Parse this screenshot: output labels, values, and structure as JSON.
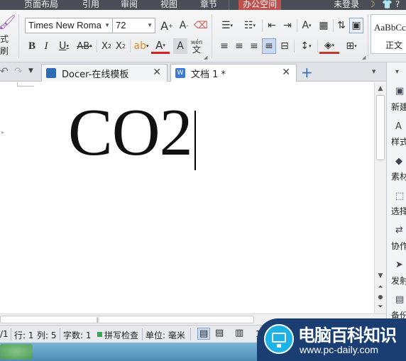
{
  "menu": {
    "items": [
      "页面布局",
      "引用",
      "审阅",
      "视图",
      "章节",
      "办公空间"
    ],
    "active": "办公空间",
    "login_status": "未登录"
  },
  "ribbon": {
    "format_painter_label": "式刷",
    "font_name": "Times New Roma",
    "font_size": "72",
    "style_preview": "AaBbCc",
    "style_name": "正文",
    "pinyin_glyph": "wén",
    "char_glyph": "文"
  },
  "tabs": [
    {
      "label": "Docer-在线模板",
      "active": false
    },
    {
      "label": "文档 1 *",
      "active": true
    }
  ],
  "document": {
    "text": "CO2"
  },
  "statusbar": {
    "page": "/1",
    "row": "行: 1",
    "col": "列: 5",
    "word_count": "字数: 1",
    "spell_check": "拼写检查",
    "unit": "单位: 毫米",
    "trailing": "1"
  },
  "sidebar": {
    "items": [
      "新建",
      "样式",
      "素材",
      "选择",
      "协作",
      "发射",
      "备份"
    ]
  },
  "watermark": {
    "title": "电脑百科知识",
    "url": "www.pc-daily.com"
  },
  "colors": {
    "menubar": "#4a4f57",
    "active_menu": "#c0504d",
    "watermark_bg": "#1a3d72",
    "watermark_logo": "#1db3e8"
  }
}
